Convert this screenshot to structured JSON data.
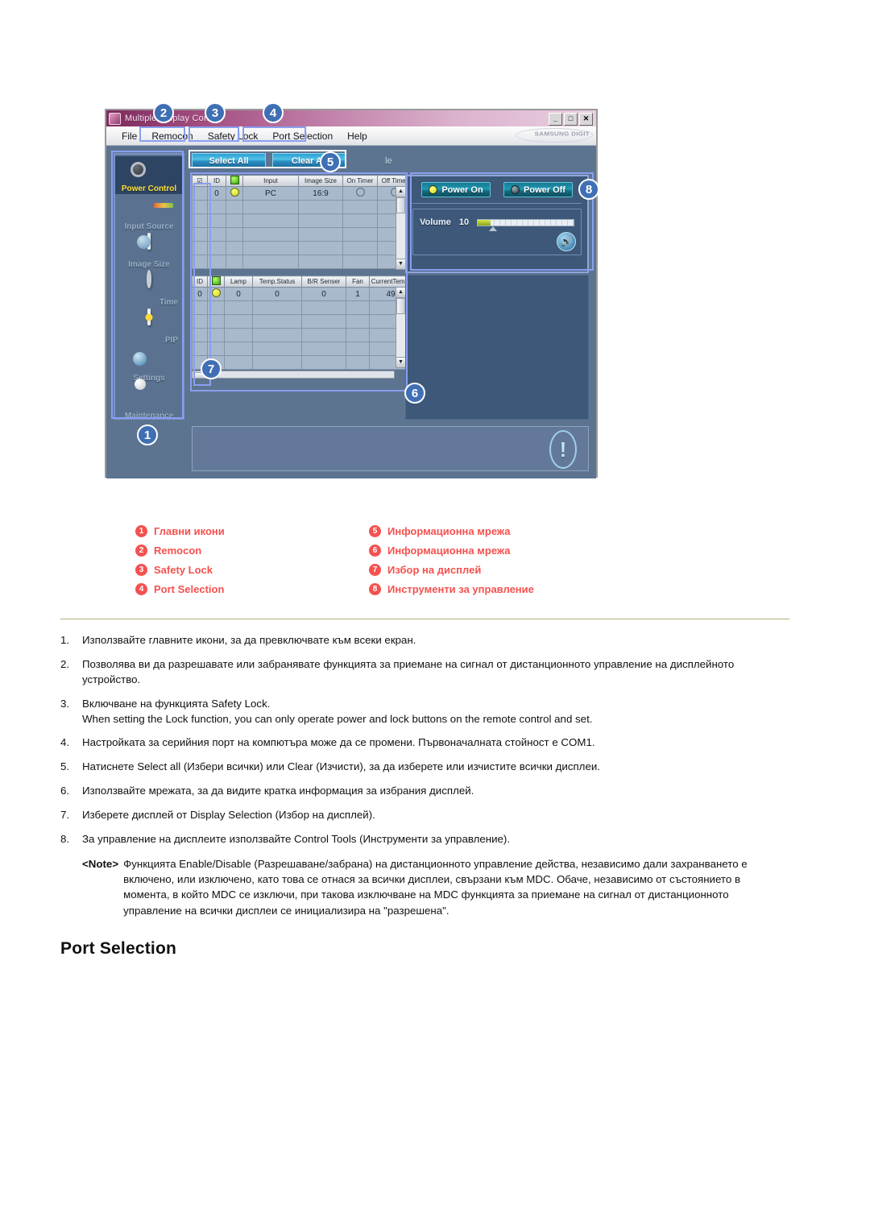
{
  "app": {
    "title": "Multiple Display Control",
    "window_buttons": [
      "_",
      "□",
      "✕"
    ],
    "brand": "SAMSUNG DIGIT",
    "menu": [
      "File",
      "Remocon",
      "Safety Lock",
      "Port Selection",
      "Help"
    ],
    "sidebar": [
      {
        "label": "Power Control",
        "icon": "power-control-icon",
        "active": true
      },
      {
        "label": "Input Source",
        "icon": "input-source-icon",
        "active": false
      },
      {
        "label": "Image Size",
        "icon": "image-size-icon",
        "active": false
      },
      {
        "label": "Time",
        "icon": "time-icon",
        "active": false
      },
      {
        "label": "PIP",
        "icon": "pip-icon",
        "active": false
      },
      {
        "label": "Settings",
        "icon": "settings-icon",
        "active": false
      },
      {
        "label": "Maintenance",
        "icon": "maintenance-icon",
        "active": false
      }
    ],
    "buttons": {
      "select_all": "Select All",
      "clear_all": "Clear All",
      "partial_label": "le"
    },
    "display_table": {
      "headers": [
        "",
        "ID",
        "",
        "Input",
        "Image Size",
        "On Timer",
        "Off Timer"
      ],
      "rows": [
        {
          "id": "0",
          "power": "●",
          "input": "PC",
          "image_size": "16:9",
          "on_timer": "○",
          "off_timer": "○"
        }
      ],
      "empty_rows": 5
    },
    "status_table": {
      "headers": [
        "ID",
        "",
        "Lamp",
        "Temp.Status",
        "B/R Senser",
        "Fan",
        "CurrentTemp."
      ],
      "rows": [
        {
          "id": "0",
          "status": "●",
          "lamp": "0",
          "temp_status": "0",
          "br_senser": "0",
          "fan": "1",
          "current_temp": "49"
        }
      ],
      "empty_rows": 5
    },
    "control_tools": {
      "power_on": "Power On",
      "power_off": "Power Off",
      "volume_label": "Volume",
      "volume_value": "10"
    },
    "callouts": [
      "1",
      "2",
      "3",
      "4",
      "5",
      "6",
      "7",
      "8"
    ]
  },
  "legend": {
    "items": [
      {
        "n": "1",
        "label": "Главни икони"
      },
      {
        "n": "2",
        "label": "Remocon"
      },
      {
        "n": "3",
        "label": "Safety Lock"
      },
      {
        "n": "4",
        "label": "Port Selection"
      },
      {
        "n": "5",
        "label": "Информационна мрежа"
      },
      {
        "n": "6",
        "label": "Информационна мрежа"
      },
      {
        "n": "7",
        "label": "Избор на дисплей"
      },
      {
        "n": "8",
        "label": "Инструменти за управление"
      }
    ]
  },
  "steps": [
    {
      "n": "1.",
      "text": "Използвайте главните икони, за да превключвате към всеки екран."
    },
    {
      "n": "2.",
      "text": "Позволява ви да разрешавате или забранявате функцията за приемане на сигнал от дистанционното управление на дисплейното устройство."
    },
    {
      "n": "3.",
      "text": "Включване на функцията Safety Lock.\nWhen setting the Lock function, you can only operate power and lock buttons on the remote control and set."
    },
    {
      "n": "4.",
      "text": "Настройката за серийния порт на компютъра може да се промени. Първоначалната стойност е COM1."
    },
    {
      "n": "5.",
      "text": "Натиснете Select all (Избери всички) или Clear (Изчисти), за да изберете или изчистите всички дисплеи."
    },
    {
      "n": "6.",
      "text": "Използвайте мрежата, за да видите кратка информация за избрания дисплей."
    },
    {
      "n": "7.",
      "text": "Изберете дисплей от Display Selection (Избор на дисплей)."
    },
    {
      "n": "8.",
      "text": "За управление на дисплеите използвайте Control Tools (Инструменти за управление)."
    }
  ],
  "note": {
    "label": "<Note>",
    "text": "Функцията Enable/Disable (Разрешаване/забрана) на дистанционното управление действа, независимо дали захранването е включено, или изключено, като това се отнася за всички дисплеи, свързани към MDC. Обаче, независимо от състоянието в момента, в който MDC се изключи, при такова изключване на MDC функцията за приемане на сигнал от дистанционното управление на всички дисплеи се инициализира на \"разрешена\"."
  },
  "page": {
    "heading": "Port Selection"
  },
  "colors": {
    "accent_red": "#f4514f",
    "callout_blue": "#3f6fb4",
    "divider": "#b2ae7a"
  }
}
